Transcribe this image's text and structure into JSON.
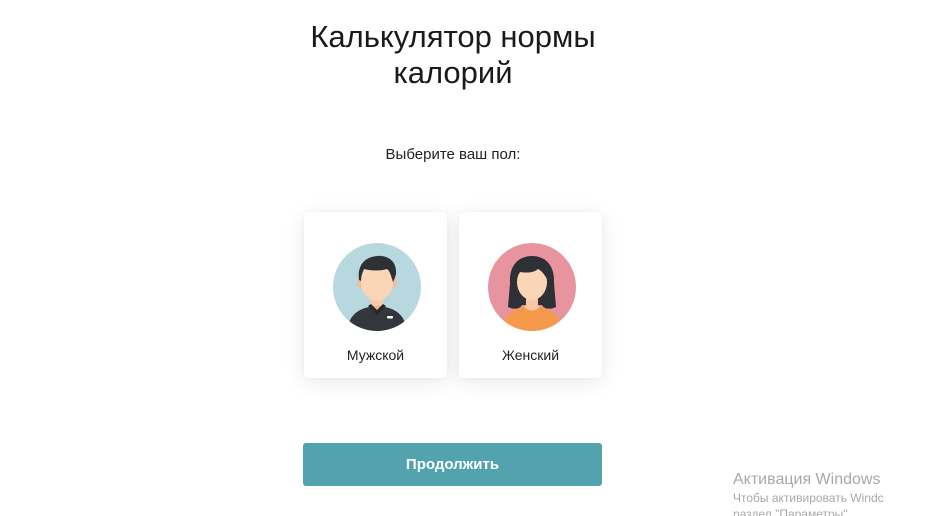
{
  "header": {
    "title": "Калькулятор нормы калорий"
  },
  "gender_prompt": "Выберите ваш пол:",
  "options": [
    {
      "label": "Мужской",
      "avatar_bg": "#b7d8de",
      "icon": "male-avatar-icon"
    },
    {
      "label": "Женский",
      "avatar_bg": "#e8949e",
      "icon": "female-avatar-icon"
    }
  ],
  "continue_button": {
    "label": "Продолжить",
    "color": "#52a3ae"
  },
  "os_watermark": {
    "title": "Активация Windows",
    "line1": "Чтобы активировать Windc",
    "line2": "раздел \"Параметры\"."
  }
}
